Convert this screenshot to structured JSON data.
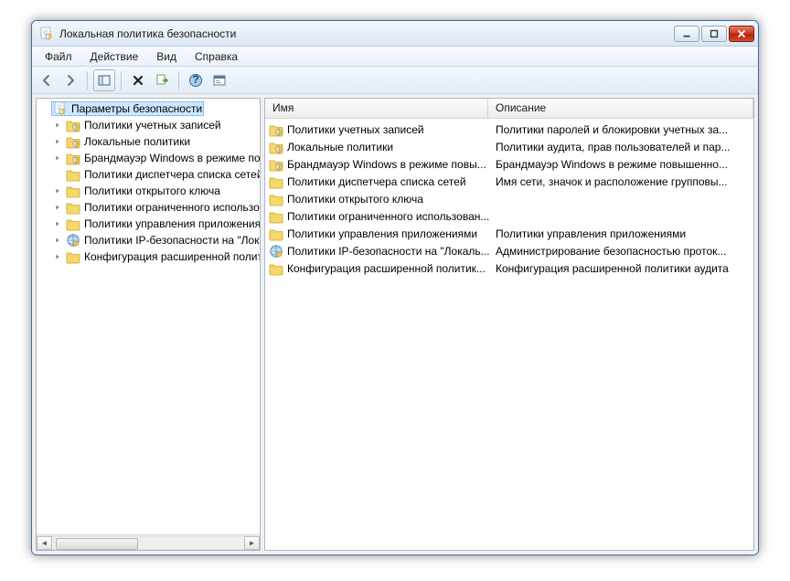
{
  "window": {
    "title": "Локальная политика безопасности"
  },
  "menu": {
    "file": "Файл",
    "action": "Действие",
    "view": "Вид",
    "help": "Справка"
  },
  "tree": {
    "root": {
      "label": "Параметры безопасности",
      "icon": "shield-doc"
    },
    "items": [
      {
        "label": "Политики учетных записей",
        "icon": "shield-folder",
        "expandable": true
      },
      {
        "label": "Локальные политики",
        "icon": "shield-folder",
        "expandable": true
      },
      {
        "label": "Брандмауэр Windows в режиме пов",
        "icon": "shield-folder",
        "expandable": true
      },
      {
        "label": "Политики диспетчера списка сетей",
        "icon": "folder",
        "expandable": false
      },
      {
        "label": "Политики открытого ключа",
        "icon": "folder",
        "expandable": true
      },
      {
        "label": "Политики ограниченного использо",
        "icon": "folder",
        "expandable": true
      },
      {
        "label": "Политики управления приложения",
        "icon": "folder",
        "expandable": true
      },
      {
        "label": "Политики IP-безопасности на \"Лока",
        "icon": "globe",
        "expandable": true
      },
      {
        "label": "Конфигурация расширенной полит",
        "icon": "folder",
        "expandable": true
      }
    ]
  },
  "list": {
    "headers": {
      "name": "Имя",
      "desc": "Описание"
    },
    "rows": [
      {
        "icon": "shield-folder",
        "name": "Политики учетных записей",
        "desc": "Политики паролей и блокировки учетных за..."
      },
      {
        "icon": "shield-folder",
        "name": "Локальные политики",
        "desc": "Политики аудита, прав пользователей и пар..."
      },
      {
        "icon": "shield-folder",
        "name": "Брандмауэр Windows в режиме повы...",
        "desc": "Брандмауэр Windows в режиме повышенно..."
      },
      {
        "icon": "folder",
        "name": "Политики диспетчера списка сетей",
        "desc": "Имя сети, значок и расположение групповы..."
      },
      {
        "icon": "folder",
        "name": "Политики открытого ключа",
        "desc": ""
      },
      {
        "icon": "folder",
        "name": "Политики ограниченного использован...",
        "desc": ""
      },
      {
        "icon": "folder",
        "name": "Политики управления приложениями",
        "desc": "Политики управления приложениями"
      },
      {
        "icon": "globe",
        "name": "Политики IP-безопасности на \"Локаль...",
        "desc": "Администрирование безопасностью проток..."
      },
      {
        "icon": "folder",
        "name": "Конфигурация расширенной политик...",
        "desc": "Конфигурация расширенной политики аудита"
      }
    ]
  }
}
